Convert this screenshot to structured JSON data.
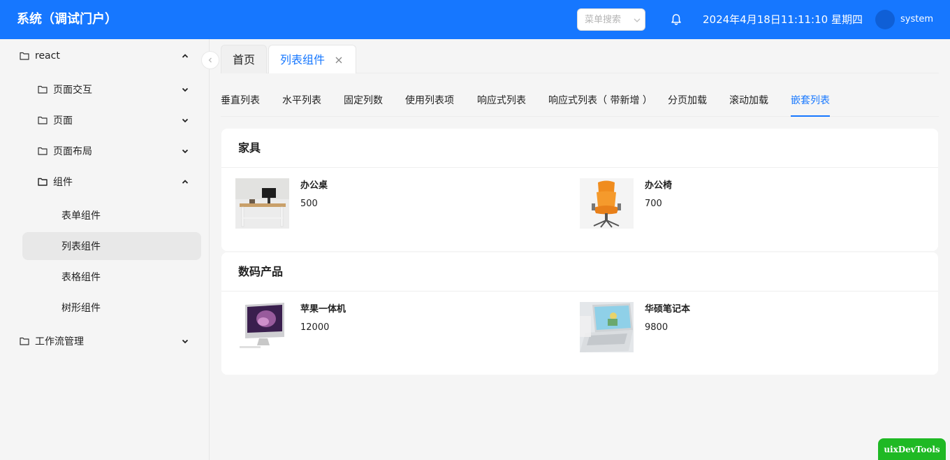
{
  "header": {
    "title": "系统（调试门户）",
    "search_placeholder": "菜单搜索",
    "datetime": "2024年4月18日11:11:10 星期四",
    "username": "system",
    "brand_color": "#1677ff"
  },
  "sidebar": {
    "items": [
      {
        "label": "react",
        "icon": "folder-icon",
        "arrow": "chevron-up-icon"
      },
      {
        "label": "页面交互",
        "icon": "folder-icon",
        "arrow": "chevron-down-icon"
      },
      {
        "label": "页面",
        "icon": "folder-icon",
        "arrow": "chevron-down-icon"
      },
      {
        "label": "页面布局",
        "icon": "folder-icon",
        "arrow": "chevron-down-icon"
      },
      {
        "label": "组件",
        "icon": "folder-icon",
        "arrow": "chevron-up-icon"
      },
      {
        "label": "表单组件"
      },
      {
        "label": "列表组件",
        "active": true
      },
      {
        "label": "表格组件"
      },
      {
        "label": "树形组件"
      },
      {
        "label": "工作流管理",
        "icon": "folder-icon",
        "arrow": "chevron-down-icon"
      }
    ]
  },
  "tabs": [
    {
      "label": "首页"
    },
    {
      "label": "列表组件",
      "active": true
    }
  ],
  "subtabs": [
    {
      "label": "垂直列表"
    },
    {
      "label": "水平列表"
    },
    {
      "label": "固定列数"
    },
    {
      "label": "使用列表项"
    },
    {
      "label": "响应式列表"
    },
    {
      "label": "响应式列表（ 带新增 ）"
    },
    {
      "label": "分页加载"
    },
    {
      "label": "滚动加载"
    },
    {
      "label": "嵌套列表",
      "active": true
    }
  ],
  "groups": [
    {
      "title": "家具",
      "items": [
        {
          "name": "办公桌",
          "price": "500",
          "image": "desk-image"
        },
        {
          "name": "办公椅",
          "price": "700",
          "image": "chair-image"
        }
      ]
    },
    {
      "title": "数码产品",
      "items": [
        {
          "name": "苹果一体机",
          "price": "12000",
          "image": "imac-image"
        },
        {
          "name": "华硕笔记本",
          "price": "9800",
          "image": "laptop-image"
        }
      ]
    }
  ],
  "devtools": {
    "label": "uixDevTools"
  }
}
